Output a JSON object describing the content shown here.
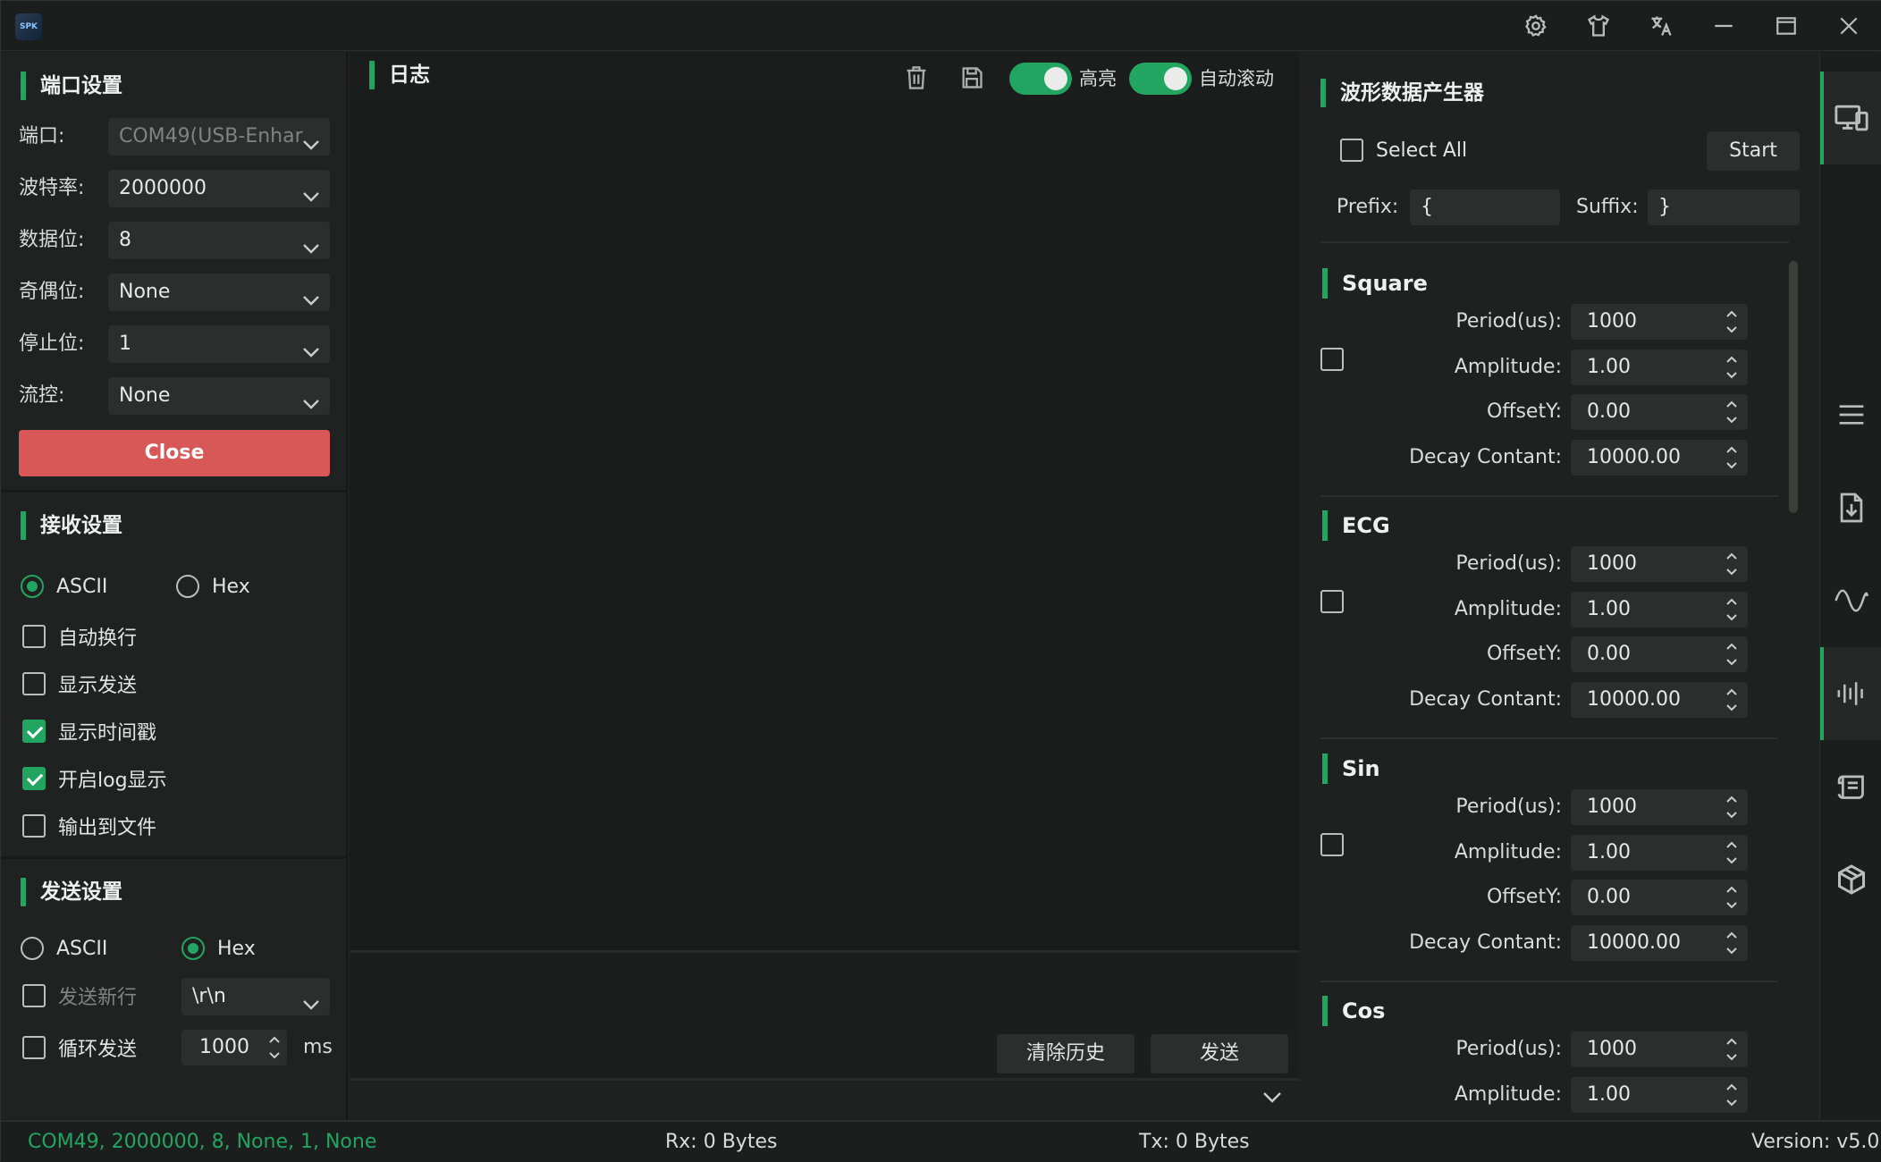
{
  "window": {
    "logo_text": "SPK",
    "controls": [
      "settings-icon",
      "tshirt-icon",
      "translate-icon",
      "minimize-icon",
      "maximize-icon",
      "close-icon"
    ]
  },
  "port_settings": {
    "title": "端口设置",
    "fields": [
      {
        "label": "端口:",
        "value": "COM49(USB-Enhar"
      },
      {
        "label": "波特率:",
        "value": "2000000"
      },
      {
        "label": "数据位:",
        "value": "8"
      },
      {
        "label": "奇偶位:",
        "value": "None"
      },
      {
        "label": "停止位:",
        "value": "1"
      },
      {
        "label": "流控:",
        "value": "None"
      }
    ],
    "close_label": "Close",
    "close_color": "#d85858"
  },
  "receive_settings": {
    "title": "接收设置",
    "radio_ascii": "ASCII",
    "radio_hex": "Hex",
    "selected": "ASCII",
    "checks": [
      {
        "label": "自动换行",
        "checked": false
      },
      {
        "label": "显示发送",
        "checked": false
      },
      {
        "label": "显示时间戳",
        "checked": true
      },
      {
        "label": "开启log显示",
        "checked": true
      },
      {
        "label": "输出到文件",
        "checked": false
      }
    ]
  },
  "send_settings": {
    "title": "发送设置",
    "radio_ascii": "ASCII",
    "radio_hex": "Hex",
    "selected": "Hex",
    "newline_label": "发送新行",
    "newline_value": "\\r\\n",
    "loop_label": "循环发送",
    "loop_value": "1000",
    "loop_unit": "ms"
  },
  "log": {
    "title": "日志",
    "highlight_label": "高亮",
    "autoscroll_label": "自动滚动",
    "highlight_on": true,
    "autoscroll_on": true,
    "clear_history_label": "清除历史",
    "send_label": "发送"
  },
  "wave": {
    "title": "波形数据产生器",
    "select_all_label": "Select All",
    "start_label": "Start",
    "prefix_label": "Prefix:",
    "prefix_value": "{",
    "suffix_label": "Suffix:",
    "suffix_value": "}",
    "groups": [
      {
        "name": "Square",
        "period_label": "Period(us):",
        "period": "1000",
        "amplitude_label": "Amplitude:",
        "amplitude": "1.00",
        "offset_label": "OffsetY:",
        "offset": "0.00",
        "decay_label": "Decay Contant:",
        "decay": "10000.00"
      },
      {
        "name": "ECG",
        "period_label": "Period(us):",
        "period": "1000",
        "amplitude_label": "Amplitude:",
        "amplitude": "1.00",
        "offset_label": "OffsetY:",
        "offset": "0.00",
        "decay_label": "Decay Contant:",
        "decay": "10000.00"
      },
      {
        "name": "Sin",
        "period_label": "Period(us):",
        "period": "1000",
        "amplitude_label": "Amplitude:",
        "amplitude": "1.00",
        "offset_label": "OffsetY:",
        "offset": "0.00",
        "decay_label": "Decay Contant:",
        "decay": "10000.00"
      },
      {
        "name": "Cos",
        "period_label": "Period(us):",
        "period": "1000",
        "amplitude_label": "Amplitude:",
        "amplitude": "1.00"
      }
    ]
  },
  "sidenav": {
    "items": [
      "devices-icon",
      "menu-icon",
      "download-file-icon",
      "wave-icon",
      "waveform-bars-icon",
      "scroll-icon",
      "package-icon"
    ],
    "active": "waveform-bars-icon"
  },
  "status": {
    "connection": "COM49, 2000000, 8, None, 1, None",
    "rx": "Rx: 0 Bytes",
    "tx": "Tx: 0 Bytes",
    "version": "Version: v5.0",
    "accent_color": "#23a562"
  }
}
